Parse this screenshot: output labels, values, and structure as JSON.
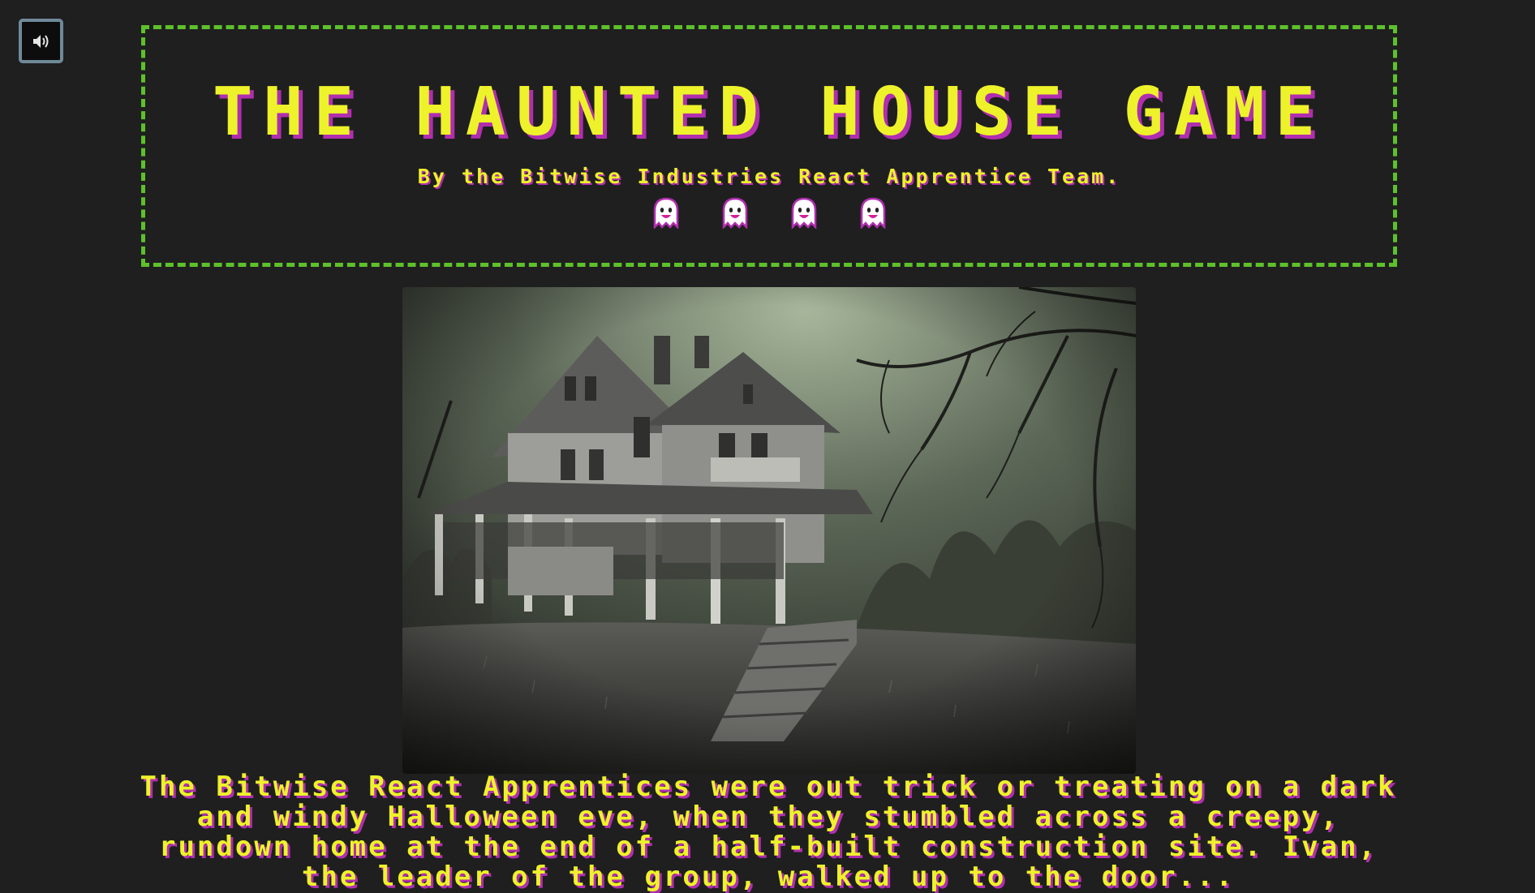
{
  "header": {
    "title": "THE HAUNTED HOUSE GAME",
    "subtitle": "By the Bitwise Industries React Apprentice Team.",
    "ghost_icons": [
      "ghost-icon",
      "ghost-icon",
      "ghost-icon",
      "ghost-icon"
    ]
  },
  "controls": {
    "sound_icon": "speaker-volume-icon"
  },
  "scene": {
    "image": "haunted-house-photo"
  },
  "story": {
    "text": "The Bitwise React Apprentices were out trick or treating on a dark and windy Halloween eve, when they stumbled across a creepy, rundown home at the end of a half-built construction site. Ivan, the leader of the group, walked up to the door..."
  },
  "colors": {
    "background": "#1f1f1f",
    "title_yellow": "#eef22a",
    "shadow_magenta": "#b02eaf",
    "border_green": "#5ec12b",
    "button_border": "#6f8a99"
  }
}
